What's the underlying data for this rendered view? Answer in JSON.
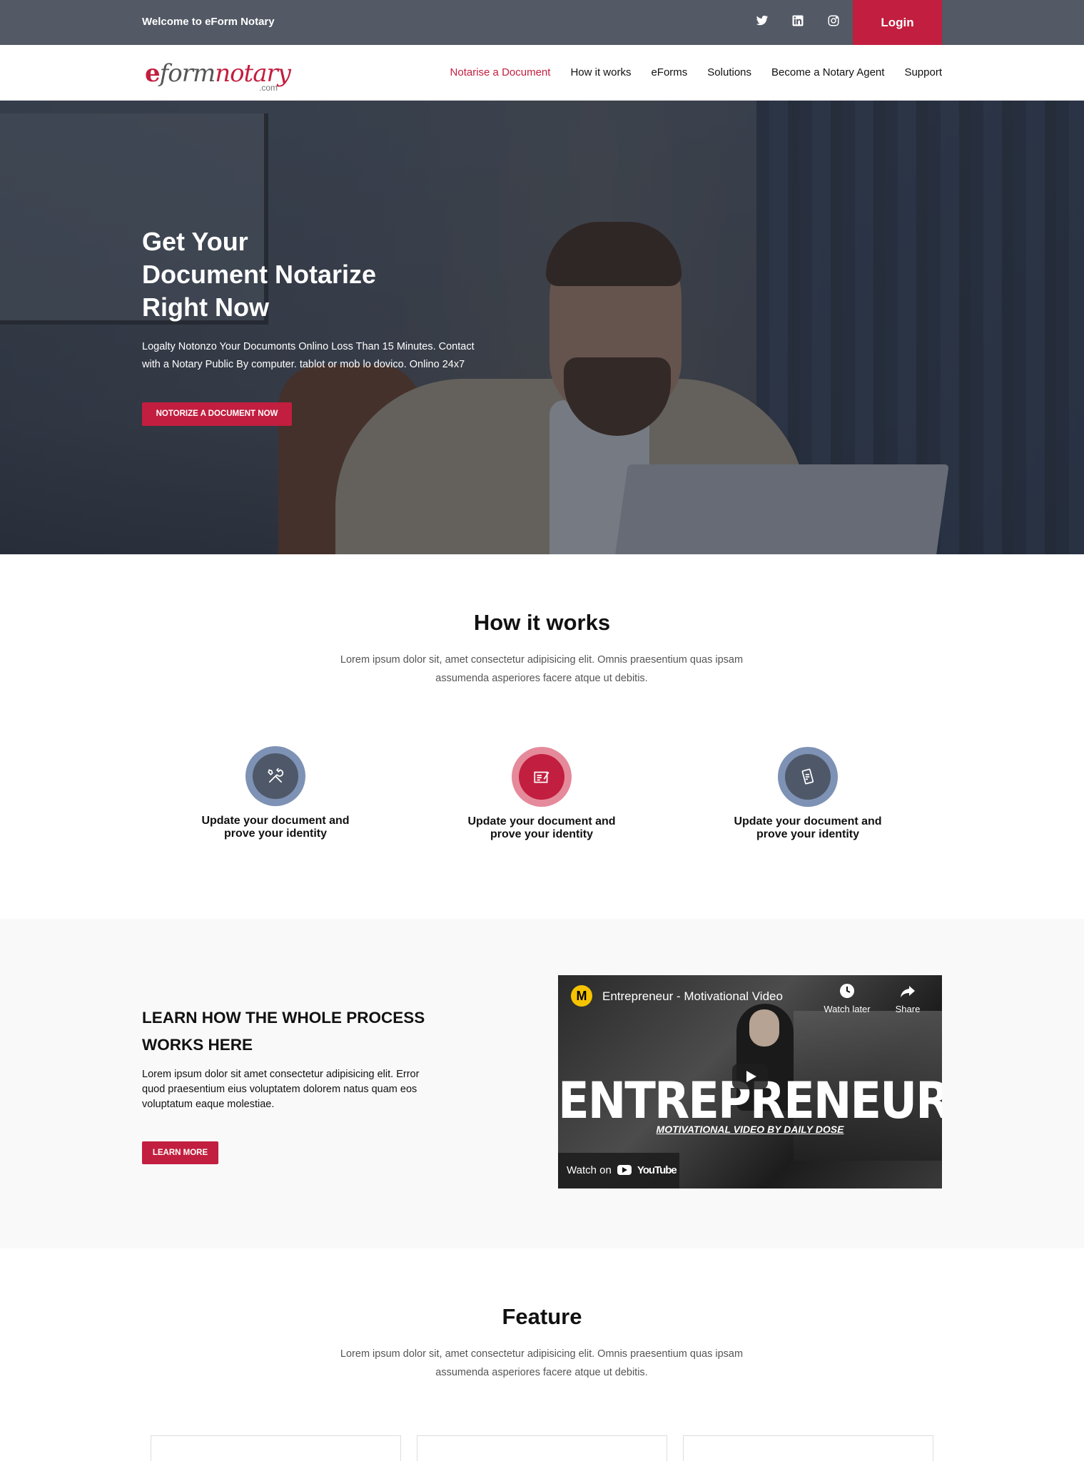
{
  "topbar": {
    "welcome": "Welcome to eForm Notary",
    "social_icons": [
      "twitter-icon",
      "linkedin-icon",
      "instagram-icon"
    ],
    "login_label": "Login",
    "colors": {
      "bar": "#535965",
      "accent": "#c21e3f"
    }
  },
  "nav": {
    "logo_main_e": "e",
    "logo_main_form": "form",
    "logo_main_notary": "notary",
    "logo_sub": ".com",
    "items": [
      {
        "label": "Notarise a Document",
        "active": true
      },
      {
        "label": "How it works"
      },
      {
        "label": "eForms"
      },
      {
        "label": "Solutions"
      },
      {
        "label": "Become a Notary Agent"
      },
      {
        "label": "Support"
      }
    ]
  },
  "hero": {
    "title_line1": "Get Your",
    "title_line2": "Document Notarize",
    "title_line3": "Right Now",
    "subtitle": "Logalty Notonzo Your Documonts Onlino Loss Than 15 Minutes. Contact with a Notary Public By computer. tablot or mob lo dovico. Onlino 24x7",
    "cta_label": "NOTORIZE A DOCUMENT NOW"
  },
  "how": {
    "title": "How it works",
    "description": "Lorem ipsum dolor sit, amet consectetur adipisicing elit. Omnis praesentium quas ipsam assumenda asperiores facere atque ut debitis.",
    "steps": [
      {
        "label": "Update your document and prove your identity",
        "icon": "tools-icon",
        "color": "#6f84a6"
      },
      {
        "label": "Update your document and prove your identity",
        "icon": "certificate-icon",
        "color": "#c21e3f"
      },
      {
        "label": "Update your document and prove your identity",
        "icon": "mobile-document-icon",
        "color": "#6f84a6"
      }
    ]
  },
  "learn": {
    "title": "LEARN HOW THE WHOLE PROCESS WORKS HERE",
    "text": "Lorem ipsum dolor sit amet consectetur adipisicing elit. Error quod praesentium eius voluptatem dolorem natus quam eos voluptatum eaque molestiae.",
    "button": "LEARN MORE",
    "video": {
      "channel_letter": "M",
      "title": "Entrepreneur - Motivational Video",
      "watch_later": "Watch later",
      "share": "Share",
      "headline": "ENTREPRENEUR",
      "headline_sub": "MOTIVATIONAL VIDEO BY DAILY DOSE",
      "watch_on": "Watch on",
      "youtube": "YouTube"
    }
  },
  "feature": {
    "title": "Feature",
    "description": "Lorem ipsum dolor sit, amet consectetur adipisicing elit. Omnis praesentium quas ipsam assumenda asperiores facere atque ut debitis."
  }
}
